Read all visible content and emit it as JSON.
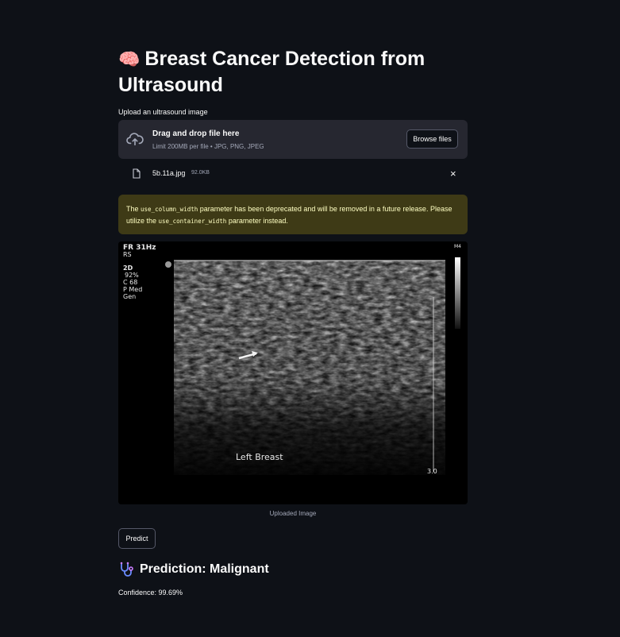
{
  "page": {
    "title_emoji": "🧠",
    "title": "Breast Cancer Detection from Ultrasound"
  },
  "uploader": {
    "label": "Upload an ultrasound image",
    "drag_text": "Drag and drop file here",
    "limit_text": "Limit 200MB per file • JPG, PNG, JPEG",
    "browse_label": "Browse files",
    "icon": "cloud-upload-icon"
  },
  "file": {
    "name": "5b.11a.jpg",
    "size": "92.0KB",
    "remove_label": "×"
  },
  "warning": {
    "text_before": "The ",
    "code1": "use_column_width",
    "text_middle": " parameter has been deprecated and will be removed in a future release. Please utilize the ",
    "code2": "use_container_width",
    "text_after": " parameter instead."
  },
  "ultrasound": {
    "header": "FR 31Hz",
    "sub": "RS",
    "mode": "2D",
    "gain": "92%",
    "c": "C 68",
    "p": "P Med",
    "gen": "Gen",
    "corner_label": "M4",
    "body_label": "Left  Breast",
    "depth": "3.0"
  },
  "image_caption": "Uploaded Image",
  "predict_label": "Predict",
  "result": {
    "icon": "stethoscope-icon",
    "heading": "Prediction: Malignant",
    "confidence": "Confidence: 99.69%"
  },
  "colors": {
    "background": "#0e1117",
    "panel": "#262730",
    "warning_bg": "#3e3a16",
    "warning_text": "#ffffc2"
  }
}
